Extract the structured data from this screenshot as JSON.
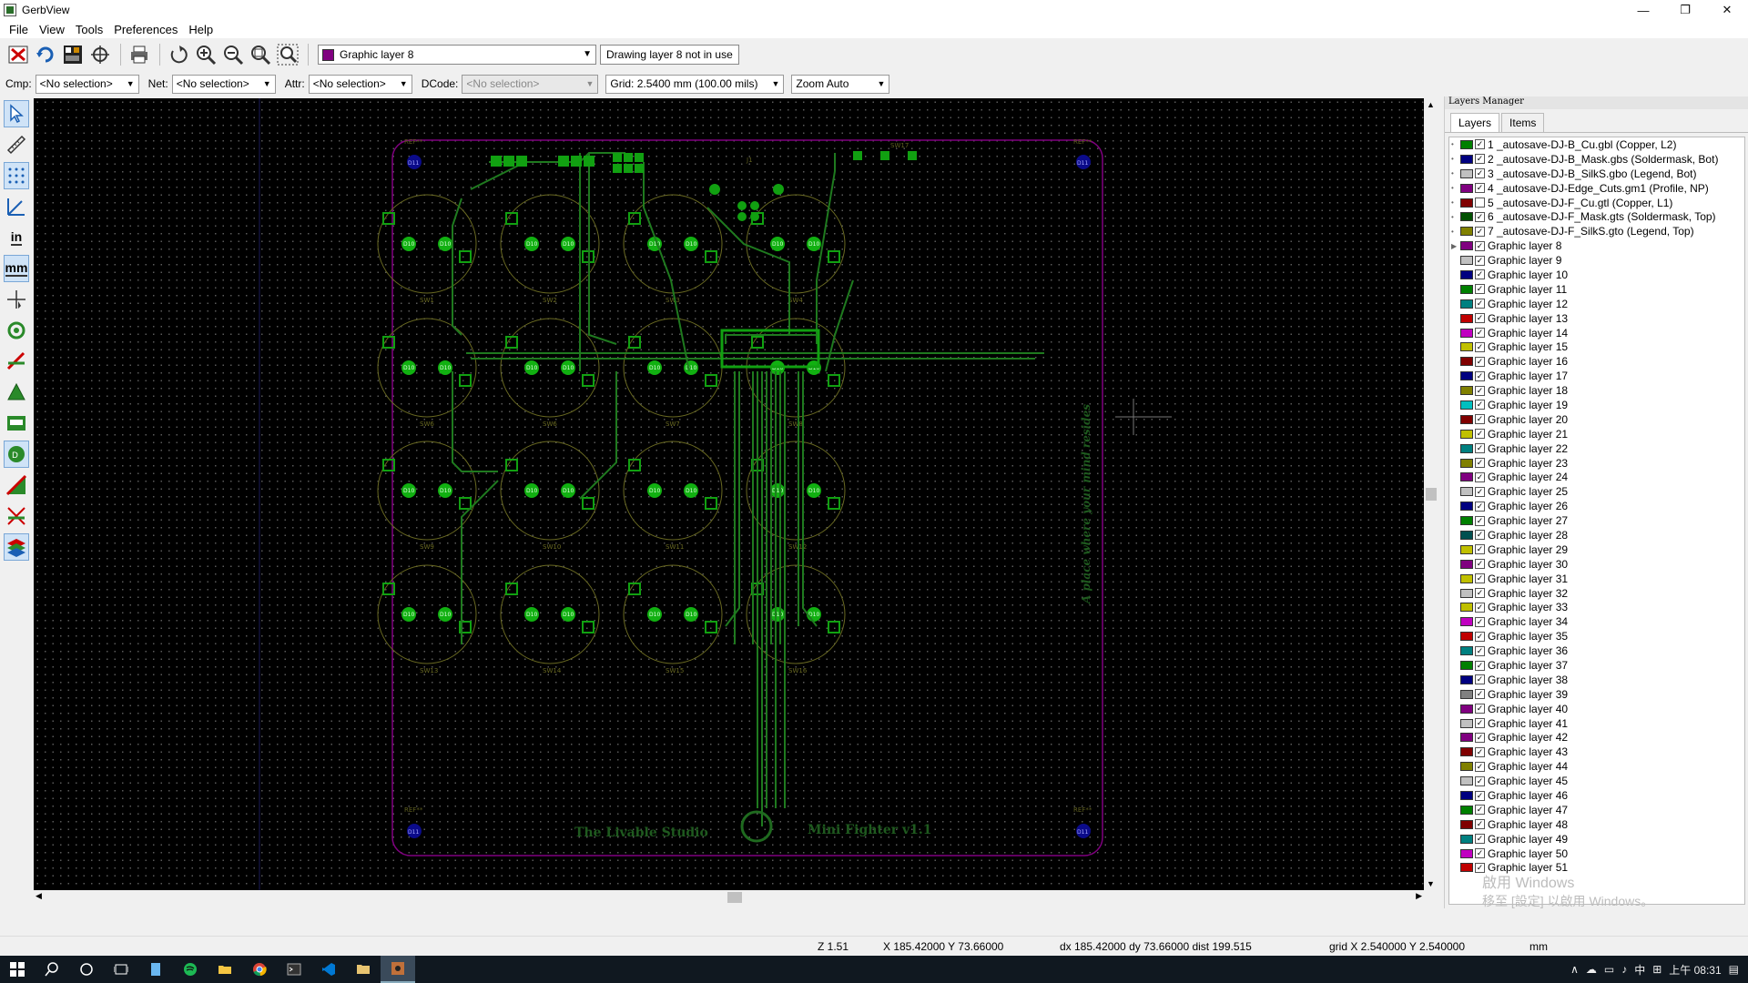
{
  "window": {
    "title": "GerbView",
    "minimize": "—",
    "maximize": "❐",
    "close": "✕"
  },
  "menu": [
    "File",
    "View",
    "Tools",
    "Preferences",
    "Help"
  ],
  "toolbar": {
    "active_layer": "Graphic layer 8",
    "active_layer_color": "#800080",
    "drawing_info": "Drawing layer 8 not in use"
  },
  "selectors": {
    "cmp_label": "Cmp:",
    "cmp_value": "<No selection>",
    "net_label": "Net:",
    "net_value": "<No selection>",
    "attr_label": "Attr:",
    "attr_value": "<No selection>",
    "dcode_label": "DCode:",
    "dcode_value": "<No selection>",
    "grid_value": "Grid: 2.5400 mm (100.00 mils)",
    "zoom_value": "Zoom Auto"
  },
  "left_tools": {
    "inch": "in",
    "mm": "mm"
  },
  "board": {
    "text_studio": "The Livable Studio",
    "text_product": "Mini Fighter v1.1",
    "text_slogan": "A place where your mind resides",
    "ref": "REF**",
    "d11": "D11",
    "d10": "D10",
    "switches": [
      "SW1",
      "SW2",
      "SW3",
      "SW4",
      "SW6",
      "SW6",
      "SW7",
      "SW8",
      "SW9",
      "SW10",
      "SW11",
      "SW12",
      "SW13",
      "SW14",
      "SW15",
      "SW16"
    ],
    "sw17": "SW17",
    "j1": "J1"
  },
  "layers_manager": {
    "title": "Layers Manager",
    "tab_layers": "Layers",
    "tab_items": "Items",
    "layers": [
      {
        "name": "1 _autosave-DJ-B_Cu.gbl (Copper, L2)",
        "color": "#008000",
        "checked": true,
        "exp": "•"
      },
      {
        "name": "2 _autosave-DJ-B_Mask.gbs (Soldermask, Bot)",
        "color": "#000080",
        "checked": true,
        "exp": "•"
      },
      {
        "name": "3 _autosave-DJ-B_SilkS.gbo (Legend, Bot)",
        "color": "#c0c0c0",
        "checked": true,
        "exp": "•"
      },
      {
        "name": "4 _autosave-DJ-Edge_Cuts.gm1 (Profile, NP)",
        "color": "#800080",
        "checked": true,
        "exp": "•"
      },
      {
        "name": "5 _autosave-DJ-F_Cu.gtl (Copper, L1)",
        "color": "#800000",
        "checked": false,
        "exp": "•"
      },
      {
        "name": "6 _autosave-DJ-F_Mask.gts (Soldermask, Top)",
        "color": "#005000",
        "checked": true,
        "exp": "•"
      },
      {
        "name": "7 _autosave-DJ-F_SilkS.gto (Legend, Top)",
        "color": "#808000",
        "checked": true,
        "exp": "•"
      },
      {
        "name": "Graphic layer 8",
        "color": "#800080",
        "checked": true,
        "exp": "▶"
      },
      {
        "name": "Graphic layer 9",
        "color": "#c0c0c0",
        "checked": true,
        "exp": ""
      },
      {
        "name": "Graphic layer 10",
        "color": "#000080",
        "checked": true,
        "exp": ""
      },
      {
        "name": "Graphic layer 11",
        "color": "#008000",
        "checked": true,
        "exp": ""
      },
      {
        "name": "Graphic layer 12",
        "color": "#008080",
        "checked": true,
        "exp": ""
      },
      {
        "name": "Graphic layer 13",
        "color": "#c00000",
        "checked": true,
        "exp": ""
      },
      {
        "name": "Graphic layer 14",
        "color": "#c000c0",
        "checked": true,
        "exp": ""
      },
      {
        "name": "Graphic layer 15",
        "color": "#c0c000",
        "checked": true,
        "exp": ""
      },
      {
        "name": "Graphic layer 16",
        "color": "#800000",
        "checked": true,
        "exp": ""
      },
      {
        "name": "Graphic layer 17",
        "color": "#000080",
        "checked": true,
        "exp": ""
      },
      {
        "name": "Graphic layer 18",
        "color": "#808000",
        "checked": true,
        "exp": ""
      },
      {
        "name": "Graphic layer 19",
        "color": "#00c0c0",
        "checked": true,
        "exp": ""
      },
      {
        "name": "Graphic layer 20",
        "color": "#800000",
        "checked": true,
        "exp": ""
      },
      {
        "name": "Graphic layer 21",
        "color": "#c0c000",
        "checked": true,
        "exp": ""
      },
      {
        "name": "Graphic layer 22",
        "color": "#008080",
        "checked": true,
        "exp": ""
      },
      {
        "name": "Graphic layer 23",
        "color": "#808000",
        "checked": true,
        "exp": ""
      },
      {
        "name": "Graphic layer 24",
        "color": "#800080",
        "checked": true,
        "exp": ""
      },
      {
        "name": "Graphic layer 25",
        "color": "#c0c0c0",
        "checked": true,
        "exp": ""
      },
      {
        "name": "Graphic layer 26",
        "color": "#000080",
        "checked": true,
        "exp": ""
      },
      {
        "name": "Graphic layer 27",
        "color": "#008000",
        "checked": true,
        "exp": ""
      },
      {
        "name": "Graphic layer 28",
        "color": "#005050",
        "checked": true,
        "exp": ""
      },
      {
        "name": "Graphic layer 29",
        "color": "#c0c000",
        "checked": true,
        "exp": ""
      },
      {
        "name": "Graphic layer 30",
        "color": "#800080",
        "checked": true,
        "exp": ""
      },
      {
        "name": "Graphic layer 31",
        "color": "#c0c000",
        "checked": true,
        "exp": ""
      },
      {
        "name": "Graphic layer 32",
        "color": "#c0c0c0",
        "checked": true,
        "exp": ""
      },
      {
        "name": "Graphic layer 33",
        "color": "#c0c000",
        "checked": true,
        "exp": ""
      },
      {
        "name": "Graphic layer 34",
        "color": "#c000c0",
        "checked": true,
        "exp": ""
      },
      {
        "name": "Graphic layer 35",
        "color": "#c00000",
        "checked": true,
        "exp": ""
      },
      {
        "name": "Graphic layer 36",
        "color": "#008080",
        "checked": true,
        "exp": ""
      },
      {
        "name": "Graphic layer 37",
        "color": "#008000",
        "checked": true,
        "exp": ""
      },
      {
        "name": "Graphic layer 38",
        "color": "#000080",
        "checked": true,
        "exp": ""
      },
      {
        "name": "Graphic layer 39",
        "color": "#808080",
        "checked": true,
        "exp": ""
      },
      {
        "name": "Graphic layer 40",
        "color": "#800080",
        "checked": true,
        "exp": ""
      },
      {
        "name": "Graphic layer 41",
        "color": "#c0c0c0",
        "checked": true,
        "exp": ""
      },
      {
        "name": "Graphic layer 42",
        "color": "#800080",
        "checked": true,
        "exp": ""
      },
      {
        "name": "Graphic layer 43",
        "color": "#800000",
        "checked": true,
        "exp": ""
      },
      {
        "name": "Graphic layer 44",
        "color": "#808000",
        "checked": true,
        "exp": ""
      },
      {
        "name": "Graphic layer 45",
        "color": "#c0c0c0",
        "checked": true,
        "exp": ""
      },
      {
        "name": "Graphic layer 46",
        "color": "#000080",
        "checked": true,
        "exp": ""
      },
      {
        "name": "Graphic layer 47",
        "color": "#008000",
        "checked": true,
        "exp": ""
      },
      {
        "name": "Graphic layer 48",
        "color": "#800000",
        "checked": true,
        "exp": ""
      },
      {
        "name": "Graphic layer 49",
        "color": "#008080",
        "checked": true,
        "exp": ""
      },
      {
        "name": "Graphic layer 50",
        "color": "#c000c0",
        "checked": true,
        "exp": ""
      },
      {
        "name": "Graphic layer 51",
        "color": "#c00000",
        "checked": true,
        "exp": ""
      }
    ]
  },
  "watermark": {
    "line1": "啟用 Windows",
    "line2": "移至 [設定] 以啟用 Windows。"
  },
  "status": {
    "zoom": "Z 1.51",
    "xy": "X 185.42000  Y 73.66000",
    "delta": "dx 185.42000  dy 73.66000  dist 199.515",
    "grid": "grid X 2.540000  Y 2.540000",
    "units": "mm"
  },
  "taskbar": {
    "time": "上午 08:31",
    "ime": "中"
  }
}
